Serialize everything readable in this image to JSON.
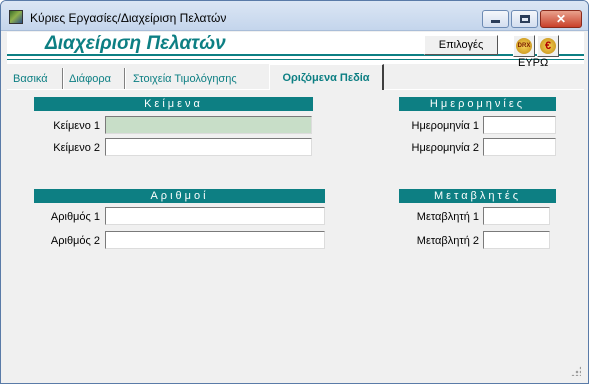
{
  "window": {
    "title": "Κύριες Εργασίες/Διαχείριση Πελατών",
    "icon": "app-icon"
  },
  "header": {
    "page_title": "Διαχείριση Πελατών",
    "options_label": "Επιλογές",
    "currency_label": "ΕΥΡΩ",
    "drx_icon_text": "DRX",
    "euro_icon_text": "€",
    "accent_color": "#0d7f83"
  },
  "tabs": [
    {
      "label": "Βασικά",
      "active": false
    },
    {
      "label": "Διάφορα",
      "active": false
    },
    {
      "label": "Στοιχεία Τιμολόγησης",
      "active": false
    },
    {
      "label": "Οριζόμενα Πεδία",
      "active": true
    }
  ],
  "sections": {
    "text": {
      "title": "Κείμενα",
      "fields": [
        {
          "label": "Κείμενο 1",
          "value": ""
        },
        {
          "label": "Κείμενο 2",
          "value": ""
        }
      ]
    },
    "dates": {
      "title": "Ημερομηνίες",
      "fields": [
        {
          "label": "Ημερομηνία 1",
          "value": ""
        },
        {
          "label": "Ημερομηνία 2",
          "value": ""
        }
      ]
    },
    "numbers": {
      "title": "Αριθμοί",
      "fields": [
        {
          "label": "Αριθμός 1",
          "value": ""
        },
        {
          "label": "Αριθμός 2",
          "value": ""
        }
      ]
    },
    "variables": {
      "title": "Μεταβλητές",
      "fields": [
        {
          "label": "Μεταβλητή 1",
          "value": ""
        },
        {
          "label": "Μεταβλητή 2",
          "value": ""
        }
      ]
    }
  }
}
